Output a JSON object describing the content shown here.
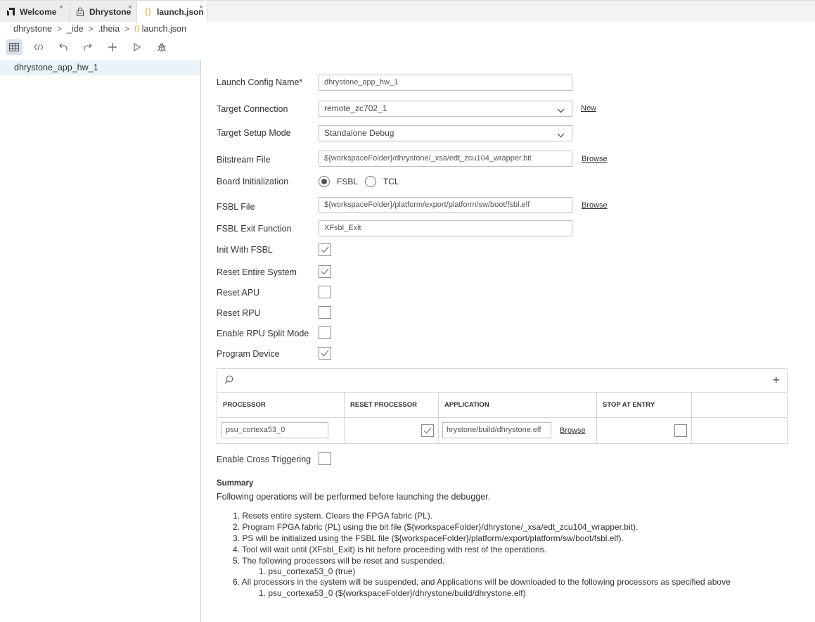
{
  "tabs": [
    {
      "label": "Welcome",
      "close": "×"
    },
    {
      "label": "Dhrystone",
      "close": "×"
    },
    {
      "label": "launch.json",
      "close": "×"
    }
  ],
  "breadcrumb": [
    "dhrystone",
    "_ide",
    ".theia",
    "launch.json"
  ],
  "breadcrumb_sep": ">",
  "file_icon_text": "{ }",
  "toolbar": {
    "icons": [
      "table-view-icon",
      "code-view-icon",
      "undo-icon",
      "redo-icon",
      "add-icon",
      "run-icon",
      "debug-icon"
    ]
  },
  "sidebar": {
    "items": [
      {
        "label": "dhrystone_app_hw_1"
      }
    ]
  },
  "form": {
    "launch_config_name": {
      "label": "Launch Config Name*",
      "value": "dhrystone_app_hw_1"
    },
    "target_connection": {
      "label": "Target Connection",
      "value": "remote_zc702_1",
      "link": "New"
    },
    "target_setup_mode": {
      "label": "Target Setup Mode",
      "value": "Standalone Debug"
    },
    "bitstream_file": {
      "label": "Bitstream File",
      "value": "${workspaceFolder}/dhrystone/_xsa/edt_zcu104_wrapper.bit",
      "link": "Browse"
    },
    "board_initialization": {
      "label": "Board Initialization",
      "options": [
        "FSBL",
        "TCL"
      ],
      "selected": "FSBL"
    },
    "fsbl_file": {
      "label": "FSBL File",
      "value": "${workspaceFolder}/platform/export/platform/sw/boot/fsbl.elf",
      "link": "Browse"
    },
    "fsbl_exit_function": {
      "label": "FSBL Exit Function",
      "value": "XFsbl_Exit"
    },
    "init_with_fsbl": {
      "label": "Init With FSBL",
      "checked": true
    },
    "reset_entire_system": {
      "label": "Reset Entire System",
      "checked": true
    },
    "reset_apu": {
      "label": "Reset APU",
      "checked": false
    },
    "reset_rpu": {
      "label": "Reset RPU",
      "checked": false
    },
    "enable_rpu_split_mode": {
      "label": "Enable RPU Split Mode",
      "checked": false
    },
    "program_device": {
      "label": "Program Device",
      "checked": true
    },
    "enable_cross_triggering": {
      "label": "Enable Cross Triggering",
      "checked": false
    }
  },
  "processor_table": {
    "add_label": "+",
    "columns": [
      "PROCESSOR",
      "RESET PROCESSOR",
      "APPLICATION",
      "STOP AT ENTRY",
      ""
    ],
    "rows": [
      {
        "processor": "psu_cortexa53_0",
        "reset_processor": true,
        "application": "hrystone/build/dhrystone.elf",
        "browse": "Browse",
        "stop_at_entry": false
      }
    ]
  },
  "summary": {
    "title": "Summary",
    "intro": "Following operations will be performed before launching the debugger.",
    "lines": [
      "1. Resets entire system. Clears the FPGA fabric (PL).",
      "2. Program FPGA fabric (PL) using the bit file (${workspaceFolder}/dhrystone/_xsa/edt_zcu104_wrapper.bit).",
      "3. PS will be initialized using the FSBL file (${workspaceFolder}/platform/export/platform/sw/boot/fsbl.elf).",
      "4. Tool will wait until (XFsbl_Exit) is hit before proceeding with rest of the operations.",
      "5. The following processors will be reset and suspended.",
      "1. psu_cortexa53_0 (true)",
      "6. All processors in the system will be suspended, and Applications will be downloaded to the following processors as specified above",
      "1. psu_cortexa53_0 (${workspaceFolder}/dhrystone/build/dhrystone.elf)"
    ]
  }
}
